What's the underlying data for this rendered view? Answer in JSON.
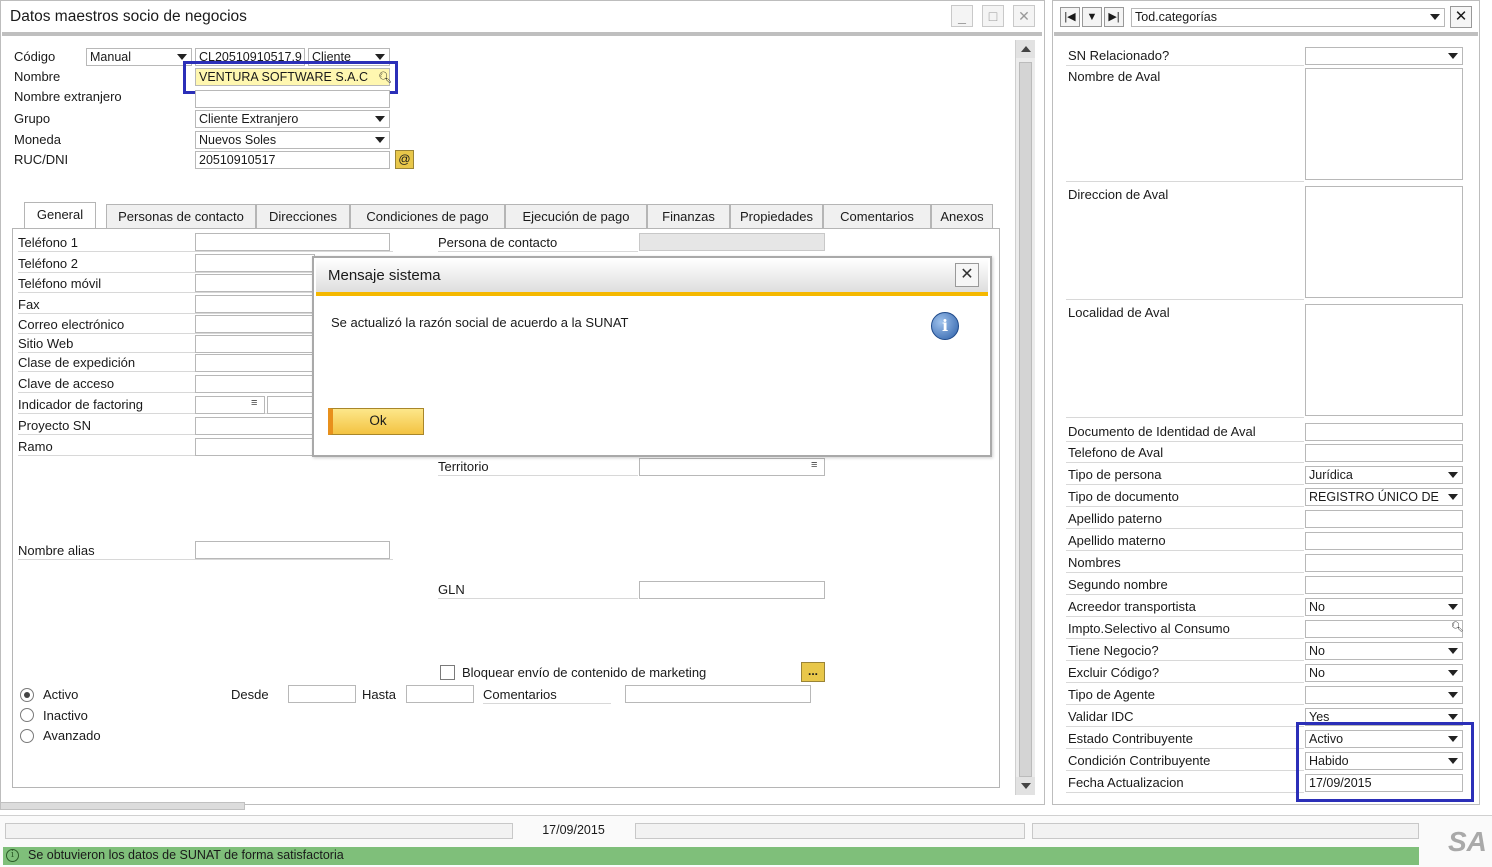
{
  "window": {
    "title": "Datos maestros socio de negocios"
  },
  "header": {
    "codigo_label": "Código",
    "codigo_series": "Manual",
    "codigo_value": "CL20510910517.9",
    "codigo_type": "Cliente",
    "nombre_label": "Nombre",
    "nombre_value": "VENTURA SOFTWARE S.A.C",
    "nombre_ext_label": "Nombre extranjero",
    "grupo_label": "Grupo",
    "grupo_value": "Cliente Extranjero",
    "moneda_label": "Moneda",
    "moneda_value": "Nuevos Soles",
    "ruc_label": "RUC/DNI",
    "ruc_value": "20510910517",
    "ruc_button": "@"
  },
  "tabs": [
    "General",
    "Personas de contacto",
    "Direcciones",
    "Condiciones de pago",
    "Ejecución de pago",
    "Finanzas",
    "Propiedades",
    "Comentarios",
    "Anexos"
  ],
  "general": {
    "left_labels": [
      "Teléfono 1",
      "Teléfono 2",
      "Teléfono móvil",
      "Fax",
      "Correo electrónico",
      "Sitio Web",
      "Clase de expedición",
      "Clave de acceso",
      "Indicador de factoring",
      "Proyecto SN",
      "Ramo"
    ],
    "persona_contacto": "Persona de contacto",
    "territorio": "Territorio",
    "nombre_alias": "Nombre alias",
    "gln": "GLN",
    "bloquear": "Bloquear envío de contenido de marketing",
    "more_button": "...",
    "activo": "Activo",
    "inactivo": "Inactivo",
    "avanzado": "Avanzado",
    "desde": "Desde",
    "hasta": "Hasta",
    "comentarios": "Comentarios"
  },
  "dialog": {
    "title": "Mensaje sistema",
    "message": "Se actualizó la razón social de acuerdo a la SUNAT",
    "ok": "Ok",
    "close": "✕"
  },
  "udf": {
    "category": "Tod.categorías",
    "close": "✕",
    "fields": [
      {
        "label": "SN Relacionado?",
        "value": ""
      },
      {
        "label": "Nombre de Aval",
        "value": ""
      },
      {
        "label": "Direccion de Aval",
        "value": ""
      },
      {
        "label": "Localidad de Aval",
        "value": ""
      },
      {
        "label": "Documento de Identidad de Aval",
        "value": ""
      },
      {
        "label": "Telefono de Aval",
        "value": ""
      },
      {
        "label": "Tipo de persona",
        "value": "Jurídica"
      },
      {
        "label": "Tipo de documento",
        "value": "REGISTRO ÚNICO DE"
      },
      {
        "label": "Apellido paterno",
        "value": ""
      },
      {
        "label": "Apellido materno",
        "value": ""
      },
      {
        "label": "Nombres",
        "value": ""
      },
      {
        "label": "Segundo nombre",
        "value": ""
      },
      {
        "label": "Acreedor transportista",
        "value": "No"
      },
      {
        "label": "Impto.Selectivo al Consumo",
        "value": ""
      },
      {
        "label": "Tiene Negocio?",
        "value": "No"
      },
      {
        "label": "Excluir Código?",
        "value": "No"
      },
      {
        "label": "Tipo de Agente",
        "value": ""
      },
      {
        "label": "Validar IDC",
        "value": "Yes"
      },
      {
        "label": "Estado Contribuyente",
        "value": "Activo"
      },
      {
        "label": "Condición Contribuyente",
        "value": "Habido"
      },
      {
        "label": "Fecha Actualizacion",
        "value": "17/09/2015"
      }
    ]
  },
  "statusbar": {
    "date": "17/09/2015",
    "message": "Se obtuvieron los datos de SUNAT de forma satisfactoria",
    "logo": "SA"
  },
  "colors": {
    "highlight": "#2b2fb8",
    "status_green": "#7fbf7a",
    "dialog_accent": "#f5b800",
    "nombre_bg": "#fff7b0"
  }
}
